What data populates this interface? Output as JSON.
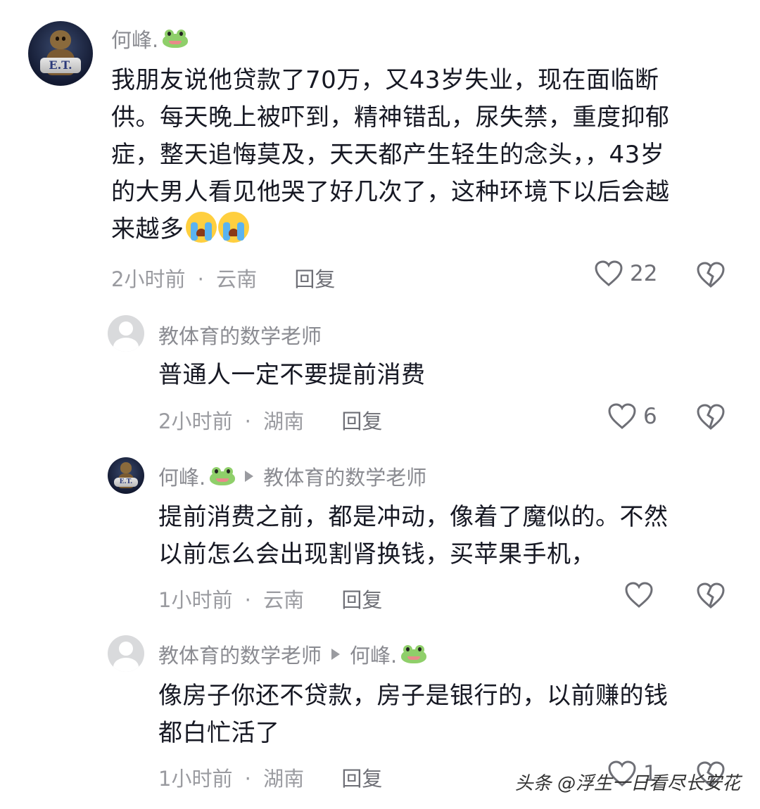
{
  "comments": [
    {
      "user": "何峰.",
      "lines": [
        "我朋友说他贷款了70万，又43岁失业，现在面临断",
        "供。每天晚上被吓到，精神错乱，尿失禁，重度抑郁",
        "症，整天追悔莫及，天天都产生轻生的念头，，43岁",
        "的大男人看见他哭了好几次了，这种环境下以后会越",
        "来越多"
      ],
      "time": "2小时前",
      "separator": "·",
      "location": "云南",
      "reply": "回复",
      "likes": "22"
    },
    {
      "user": "教体育的数学老师",
      "lines": [
        "普通人一定不要提前消费"
      ],
      "time": "2小时前",
      "separator": "·",
      "location": "湖南",
      "reply": "回复",
      "likes": "6"
    },
    {
      "user": "何峰.",
      "reply_to": "教体育的数学老师",
      "lines": [
        "提前消费之前，都是冲动，像着了魔似的。不然",
        "以前怎么会出现割肾换钱，买苹果手机，"
      ],
      "time": "1小时前",
      "separator": "·",
      "location": "云南",
      "reply": "回复",
      "likes": ""
    },
    {
      "user": "教体育的数学老师",
      "reply_to": "何峰.",
      "lines": [
        "像房子你还不贷款，房子是银行的，以前赚的钱",
        "都白忙活了"
      ],
      "time": "1小时前",
      "separator": "·",
      "location": "湖南",
      "reply": "回复",
      "likes": "1"
    }
  ],
  "emoji": [
    "frog-emoji",
    "crying-face-emoji"
  ],
  "watermark": "头条 @浮生一日看尽长安花",
  "colors": {
    "text": "#161823",
    "meta": "#9a9ba0",
    "frog": "#8fcf6a"
  }
}
